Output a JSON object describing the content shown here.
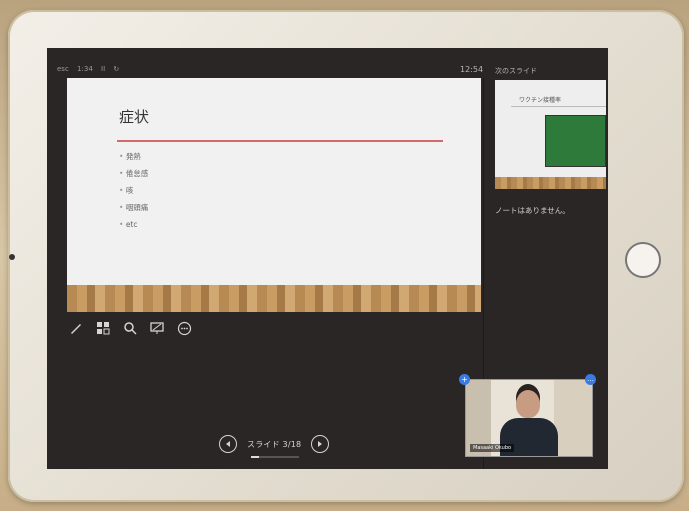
{
  "status_bar": {
    "left": [
      "esc",
      "1:34",
      "II",
      "↻"
    ],
    "time": "12:54",
    "next_slide_label": "次のスライド"
  },
  "slide": {
    "title": "症状",
    "bullets": [
      "発熱",
      "倦怠感",
      "咳",
      "咽頭痛",
      "etc"
    ]
  },
  "next_slide": {
    "title": "ワクチン接種率"
  },
  "notes": {
    "text": "ノートはありません。"
  },
  "toolbar": {
    "tools": [
      "pen-icon",
      "slides-grid-icon",
      "search-icon",
      "screen-icon",
      "more-icon"
    ]
  },
  "navigation": {
    "counter": "スライド 3/18",
    "current": 3,
    "total": 18
  },
  "video": {
    "participant_name": "Masaaki Okubo"
  },
  "colors": {
    "screen_bg": "#2a2626",
    "accent_rule": "#d26a6a",
    "video_badge": "#3b7be0"
  }
}
